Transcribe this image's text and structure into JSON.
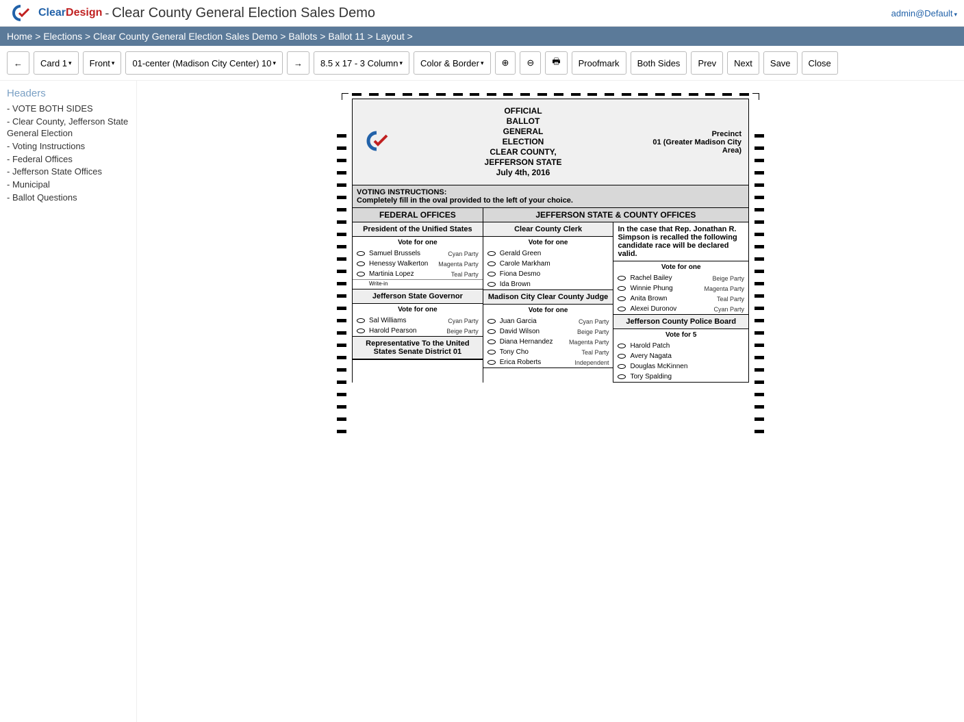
{
  "header": {
    "brand_clear": "Clear",
    "brand_design": "Design",
    "title": "Clear County General Election Sales Demo",
    "user": "admin@Default"
  },
  "breadcrumb": [
    "Home",
    "Elections",
    "Clear County General Election Sales Demo",
    "Ballots",
    "Ballot 11",
    "Layout"
  ],
  "toolbar": {
    "back": "←",
    "card": "Card 1",
    "side": "Front",
    "precinct": "01-center (Madison City Center) 10",
    "forward": "→",
    "paper": "8.5 x 17 - 3 Column",
    "color": "Color & Border",
    "proofmark": "Proofmark",
    "both": "Both Sides",
    "prev": "Prev",
    "next": "Next",
    "save": "Save",
    "close": "Close"
  },
  "sidebar": {
    "title": "Headers",
    "items": [
      "- VOTE BOTH SIDES",
      "- Clear County, Jefferson State General Election",
      "- Voting Instructions",
      "- Federal Offices",
      "- Jefferson State Offices",
      "- Municipal",
      "- Ballot Questions"
    ]
  },
  "ballot": {
    "official": "OFFICIAL\nBALLOT\nGENERAL\nELECTION\nCLEAR COUNTY,\nJEFFERSON STATE\nJuly 4th, 2016",
    "precinct_label": "Precinct",
    "precinct_value": "01 (Greater Madison City Area)",
    "instructions_title": "VOTING INSTRUCTIONS:",
    "instructions_text": "Completely fill in the oval provided to the left of your choice.",
    "sec1": "FEDERAL OFFICES",
    "sec2": "JEFFERSON STATE & COUNTY OFFICES",
    "contests": {
      "president": {
        "title": "President of the Unified States",
        "vote": "Vote for one",
        "cands": [
          {
            "n": "Samuel Brussels",
            "p": "Cyan Party"
          },
          {
            "n": "Henessy Walkerton",
            "p": "Magenta Party"
          },
          {
            "n": "Martinia Lopez",
            "p": "Teal Party"
          }
        ],
        "writein": "Write-in"
      },
      "governor": {
        "title": "Jefferson State Governor",
        "vote": "Vote for one",
        "cands": [
          {
            "n": "Sal Williams",
            "p": "Cyan Party"
          },
          {
            "n": "Harold Pearson",
            "p": "Beige Party"
          }
        ]
      },
      "rep": {
        "title": "Representative To the United States Senate District 01"
      },
      "clerk": {
        "title": "Clear County Clerk",
        "vote": "Vote for one",
        "cands": [
          {
            "n": "Gerald Green",
            "p": ""
          },
          {
            "n": "Carole Markham",
            "p": ""
          },
          {
            "n": "Fiona Desmo",
            "p": ""
          },
          {
            "n": "Ida Brown",
            "p": ""
          }
        ]
      },
      "judge": {
        "title": "Madison City Clear County Judge",
        "vote": "Vote for one",
        "cands": [
          {
            "n": "Juan Garcia",
            "p": "Cyan Party"
          },
          {
            "n": "David Wilson",
            "p": "Beige Party"
          },
          {
            "n": "Diana Hernandez",
            "p": "Magenta Party"
          },
          {
            "n": "Tony Cho",
            "p": "Teal Party"
          },
          {
            "n": "Erica Roberts",
            "p": "Independent"
          }
        ]
      },
      "recall": {
        "title": "In the case that Rep. Jonathan R. Simpson is recalled the following candidate race will be declared valid.",
        "vote": "Vote for one",
        "cands": [
          {
            "n": "Rachel Bailey",
            "p": "Beige Party"
          },
          {
            "n": "Winnie Phung",
            "p": "Magenta Party"
          },
          {
            "n": "Anita Brown",
            "p": "Teal Party"
          },
          {
            "n": "Alexei Duronov",
            "p": "Cyan Party"
          }
        ]
      },
      "police": {
        "title": "Jefferson County Police Board",
        "vote": "Vote for 5",
        "cands": [
          {
            "n": "Harold Patch",
            "p": ""
          },
          {
            "n": "Avery Nagata",
            "p": ""
          },
          {
            "n": "Douglas McKinnen",
            "p": ""
          },
          {
            "n": "Tory Spalding",
            "p": ""
          }
        ]
      }
    }
  }
}
